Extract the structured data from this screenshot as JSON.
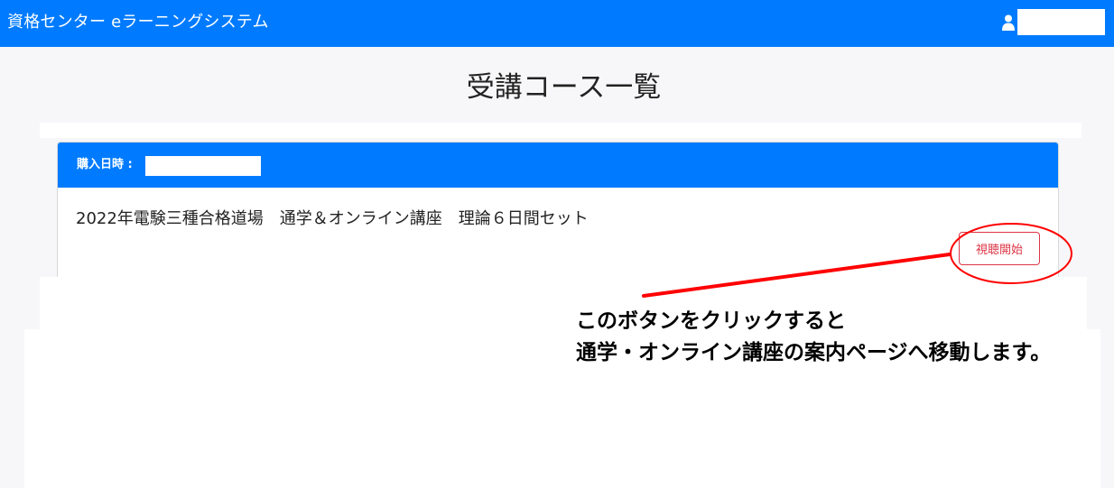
{
  "header": {
    "app_title": "資格センター eラーニングシステム",
    "user_icon": "user-icon",
    "user_name": ""
  },
  "page": {
    "title": "受講コース一覧"
  },
  "course_card": {
    "purchase_date_label": "購入日時 :",
    "purchase_date_value": "",
    "course_name": "2022年電験三種合格道場　通学＆オンライン講座　理論６日間セット",
    "watch_button_label": "視聴開始"
  },
  "annotation": {
    "line1": "このボタンをクリックすると",
    "line2": "通学・オンライン講座の案内ページへ移動します。",
    "color": "#ff0000"
  },
  "colors": {
    "primary": "#007bff",
    "danger": "#dc3545",
    "background": "#f7f7f9"
  }
}
